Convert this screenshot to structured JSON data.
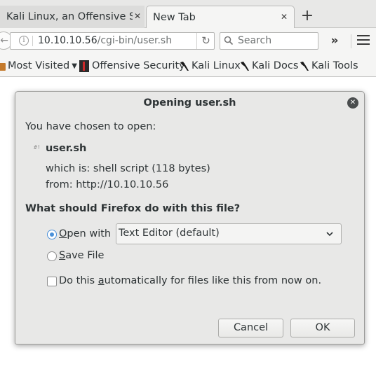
{
  "tabs": [
    {
      "label": "Kali Linux, an Offensive S…",
      "close_glyph": "✕"
    },
    {
      "label": "New Tab",
      "close_glyph": "✕"
    }
  ],
  "new_tab_glyph": "+",
  "navbar": {
    "back_glyph": "←",
    "url_host": "10.10.10.56",
    "url_path": "/cgi-bin/user.sh",
    "info_glyph": "i",
    "reload_glyph": "↻",
    "search_placeholder": "Search",
    "overflow_glyph": "»"
  },
  "bookmarks": [
    {
      "label": "Most Visited",
      "icon": "folder-icon"
    },
    {
      "label": "Offensive Security",
      "icon": "offensive-security-icon"
    },
    {
      "label": "Kali Linux",
      "icon": "kali-dragon-icon"
    },
    {
      "label": "Kali Docs",
      "icon": "kali-dragon-icon"
    },
    {
      "label": "Kali Tools",
      "icon": "kali-dragon-icon"
    }
  ],
  "dialog": {
    "title": "Opening user.sh",
    "close_glyph": "✕",
    "intro": "You have chosen to open:",
    "file_icon_glyph": "#!",
    "filename": "user.sh",
    "which_is": "which is:  shell script (118 bytes)",
    "from": "from:  http://10.10.10.56",
    "question": "What should Firefox do with this file?",
    "open_with": {
      "label_mnemonic": "O",
      "label_rest": "pen with",
      "selected": true
    },
    "app_select": {
      "value": "Text Editor (default)"
    },
    "save_file": {
      "label_mnemonic": "S",
      "label_rest": "ave File",
      "selected": false
    },
    "auto": {
      "label_pre": "Do this ",
      "label_mnemonic": "a",
      "label_rest": "utomatically for files like this from now on.",
      "checked": false
    },
    "cancel_label": "Cancel",
    "ok_label": "OK"
  },
  "colors": {
    "accent": "#4a90d9",
    "dialog_bg": "#e8e8e7",
    "chrome_bg": "#f5f5f4"
  }
}
